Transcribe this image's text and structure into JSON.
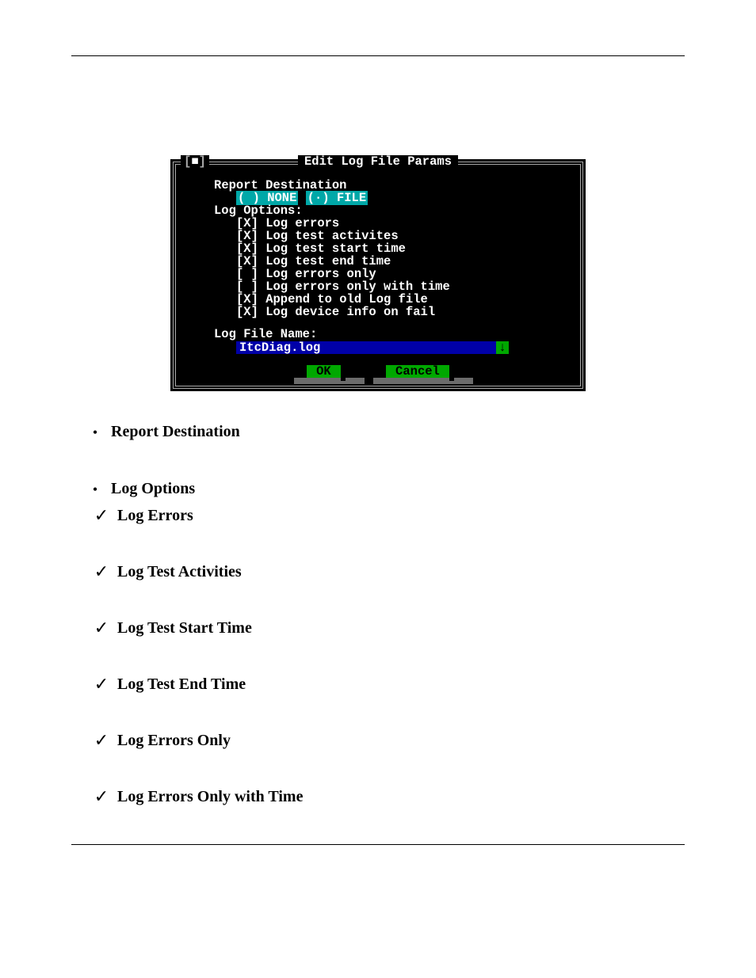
{
  "dialog": {
    "close_box": "[■]",
    "title": "Edit Log File Params",
    "section_report": "Report Destination",
    "radio_none": "( ) NONE",
    "radio_file": "(∙) FILE",
    "section_options": "Log Options:",
    "checks": [
      "[X] Log errors",
      "[X] Log test activites",
      "[X] Log test start time",
      "[X] Log test end time",
      "[ ] Log errors only",
      "[ ] Log errors only with time",
      "[X] Append to old Log file",
      "[X] Log device info on fail"
    ],
    "section_filename": "Log File Name:",
    "filename_value": "ItcDiag.log",
    "drop_glyph": "↓",
    "btn_ok": "OK",
    "btn_cancel": "Cancel"
  },
  "doc": {
    "items": [
      {
        "marker": "bullet",
        "text": "Report Destination"
      },
      {
        "marker": "bullet",
        "text": "Log Options"
      },
      {
        "marker": "check",
        "text": "Log Errors"
      },
      {
        "marker": "check",
        "text": "Log Test Activities"
      },
      {
        "marker": "check",
        "text": "Log Test Start Time"
      },
      {
        "marker": "check",
        "text": "Log Test End Time"
      },
      {
        "marker": "check",
        "text": "Log Errors Only"
      },
      {
        "marker": "check",
        "text": "Log Errors Only with Time"
      }
    ]
  }
}
